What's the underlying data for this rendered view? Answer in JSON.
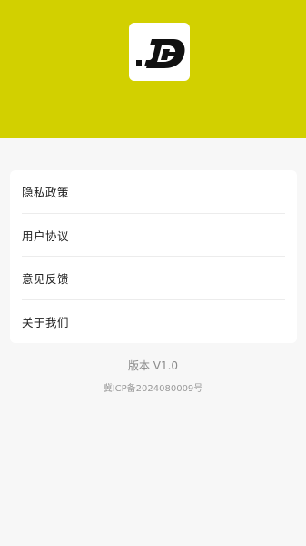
{
  "theme": {
    "header_color": "#d2d000",
    "logo_bg": "#ffffff",
    "card_bg": "#ffffff",
    "page_bg": "#f7f7f7"
  },
  "header": {
    "logo_icon": "jd-app-logo"
  },
  "menu": {
    "items": [
      {
        "label": "隐私政策"
      },
      {
        "label": "用户协议"
      },
      {
        "label": "意见反馈"
      },
      {
        "label": "关于我们"
      }
    ]
  },
  "footer": {
    "version": "版本 V1.0",
    "icp": "冀ICP备2024080009号"
  }
}
